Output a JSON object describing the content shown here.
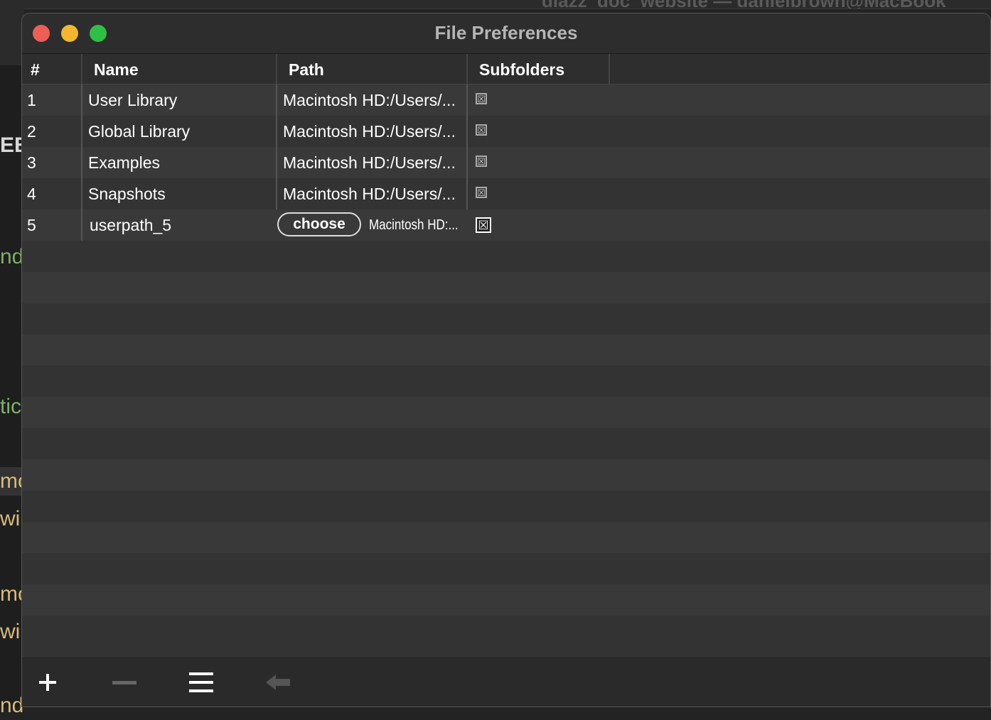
{
  "background": {
    "editor_title": "diazz_doc_website — danielbrown@MacBook",
    "fragments": [
      {
        "text": "EE",
        "color": "#d8d8d8"
      },
      {
        "text": "nd",
        "color": "#7fb069"
      },
      {
        "text": "tic",
        "color": "#7fb069"
      },
      {
        "text": "mc",
        "color": "#d7ba7d"
      },
      {
        "text": "wir",
        "color": "#d7ba7d"
      },
      {
        "text": "mc",
        "color": "#d7ba7d"
      },
      {
        "text": "win",
        "color": "#d7ba7d"
      },
      {
        "text": "nd",
        "color": "#d7ba7d"
      }
    ]
  },
  "window": {
    "title": "File Preferences"
  },
  "table": {
    "columns": [
      "#",
      "Name",
      "Path",
      "Subfolders"
    ],
    "rows": [
      {
        "num": "1",
        "name": "User Library",
        "path": "Macintosh HD:/Users/...",
        "subfolders": "☒"
      },
      {
        "num": "2",
        "name": "Global Library",
        "path": "Macintosh HD:/Users/...",
        "subfolders": "☒"
      },
      {
        "num": "3",
        "name": "Examples",
        "path": "Macintosh HD:/Users/...",
        "subfolders": "☒"
      },
      {
        "num": "4",
        "name": "Snapshots",
        "path": "Macintosh HD:/Users/...",
        "subfolders": "☒"
      }
    ],
    "edit_row": {
      "num": "5",
      "name": "userpath_5",
      "choose_label": "choose",
      "path": "Macintosh HD:...",
      "subfolders": "☒"
    }
  },
  "toolbar": {
    "add_icon": "plus-icon",
    "remove_icon": "minus-icon",
    "menu_icon": "list-icon",
    "back_icon": "arrow-left-icon"
  },
  "colors": {
    "close": "#ec5f57",
    "minimize": "#f2b730",
    "zoom": "#2fbf47"
  }
}
